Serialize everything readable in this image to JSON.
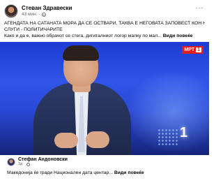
{
  "post": {
    "author": "Стеван Здравески",
    "time": "43 мин.",
    "separator": "·",
    "more_label": "···",
    "text_line1": "АГЕНДАТА НА САТАНАТА МОРА ДА СЕ ОСТВАРИ, ТАКВА Е НЕГОВАТА ЗАПОВЕСТ КОН НЕГОВИТЕ",
    "text_line2": "СЛУГИ - ПОЛИТИЧАРИТЕ",
    "text_line3": "Како и да е, важно обрачот се стега, дигиталниот логор малку по мал...",
    "see_more": "Види повеќе"
  },
  "media": {
    "channel_logo_text": "МРТ",
    "channel_logo_num": "1",
    "studio_number": "1"
  },
  "shared_post": {
    "author": "Стефан Андоновски",
    "time": "3д",
    "text": "Македонија ќе гради Национален дата центар...",
    "see_more": "Види повеќе"
  },
  "colors": {
    "accent_red": "#e31d1a",
    "studio_blue": "#2f55e8",
    "secondary_text": "#65676b"
  }
}
